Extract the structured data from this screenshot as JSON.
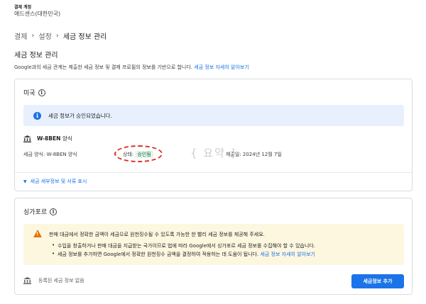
{
  "account": {
    "label": "결제 계정",
    "name": "애드센스(대한민국)"
  },
  "breadcrumb": {
    "items": [
      "결제",
      "설정",
      "세금 정보 관리"
    ],
    "separator": "›"
  },
  "page": {
    "title": "세금 정보 관리",
    "intro": "Google과의 세금 관계는 제출한 세금 정보 및 결제 프로필의 정보를 기반으로 합니다.",
    "intro_link": "세금 정보 자세히 알아보기"
  },
  "us_section": {
    "country": "미국",
    "banner": "세금 정보가 승인되었습니다.",
    "form_name": "W-8BEN",
    "form_suffix": "양식",
    "detail_form": "세금 양식: W-8BEN 양식",
    "status_label": "상태:",
    "status_value": "승인됨",
    "submitted": "제출일: 2024년 12월 7일",
    "watermark": "{ 요약 }",
    "expand_label": "세금 세부정보 및 서류 표시"
  },
  "sg_section": {
    "country": "싱가포르",
    "warning_main": "판매 대금에서 정확한 금액이 세금으로 원천징수될 수 있도록 가능한 한 빨리 세금 정보를 제공해 주세요.",
    "bullet1": "수입을 창출하거나 판매 대금을 지급받는 국가이므로 법에 따라 Google에서 싱가포르 세금 정보를 수집해야 할 수 있습니다.",
    "bullet2": "세금 정보를 추가하면 Google에서 정확한 원천징수 금액을 결정하여 적용하는 데 도움이 됩니다.",
    "bullet2_link": "세금 정보 자세히 알아보기",
    "none_text": "등록된 세금 정보 없음",
    "add_button": "세금정보 추가"
  },
  "colors": {
    "accent": "#1a73e8",
    "approved_bg": "#e6f4ea",
    "approved_text": "#137333",
    "warning": "#e37400",
    "highlight": "#d93025"
  }
}
